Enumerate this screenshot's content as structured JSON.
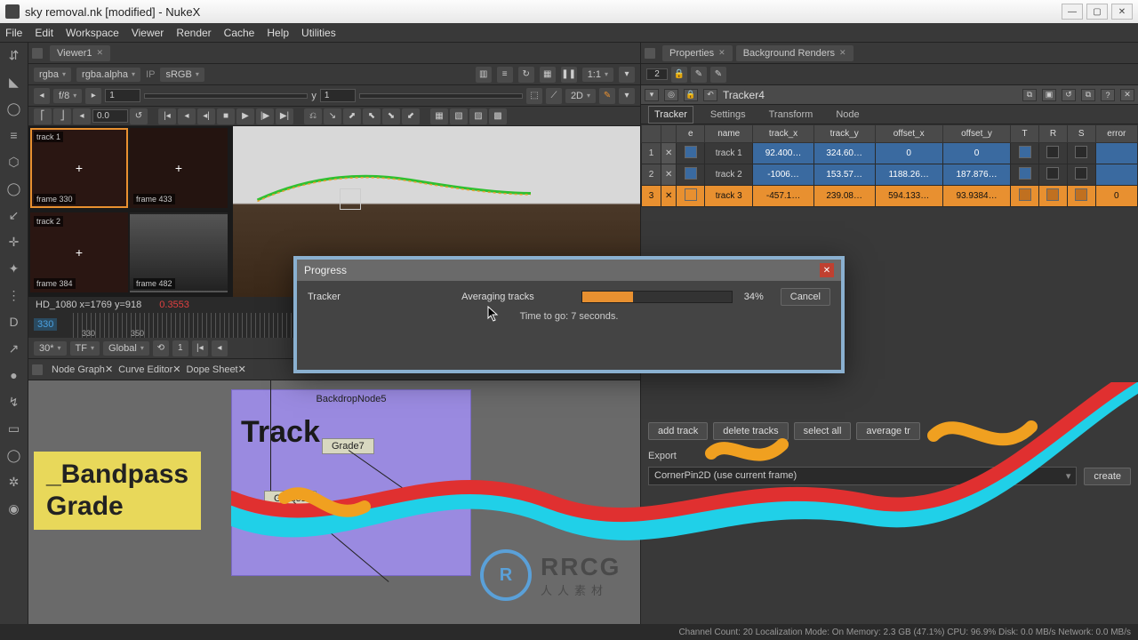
{
  "window": {
    "title": "sky removal.nk [modified] - NukeX"
  },
  "menus": [
    "File",
    "Edit",
    "Workspace",
    "Viewer",
    "Render",
    "Cache",
    "Help",
    "Utilities"
  ],
  "left_tools": [
    "⇵",
    "▲",
    "◯",
    "≡",
    "⬡",
    "◯",
    "↙",
    "✛",
    "✦",
    "⋮",
    "D",
    "↗",
    "●",
    "↯",
    "⌂",
    "◯",
    "✲",
    "◉"
  ],
  "viewer": {
    "tab": "Viewer1",
    "channel": "rgba",
    "alpha": "rgba.alpha",
    "ip": "IP",
    "lut": "sRGB",
    "ratio": "1:1",
    "fstop": "f/8",
    "proxy": "1",
    "ylabel": "y",
    "yval": "1",
    "mode2d": "2D",
    "gain": "0.0",
    "info": "HD_1080   x=1769 y=918",
    "red_val": "0.3553",
    "frame": "330",
    "ticks": [
      "330",
      "350"
    ],
    "fps": "30*",
    "tf": "TF",
    "scope": "Global"
  },
  "thumbs": [
    {
      "track": "track 1",
      "frame": "frame 330"
    },
    {
      "track": "",
      "frame": "frame 433"
    },
    {
      "track": "track 2",
      "frame": "frame 384"
    },
    {
      "track": "",
      "frame": "frame 482"
    }
  ],
  "lower_tabs": [
    "Node Graph",
    "Curve Editor",
    "Dope Sheet"
  ],
  "node_graph": {
    "backdrop": "BackdropNode5",
    "big": "Track",
    "nodes": {
      "grade7": "Grade7",
      "grade1": "Grade1",
      "tracker": "Tracker4"
    },
    "yellow": [
      "_Bandpass",
      " Grade"
    ]
  },
  "props": {
    "tab1": "Properties",
    "tab2": "Background Renders",
    "count": "2",
    "node": "Tracker4",
    "subtabs": [
      "Tracker",
      "Settings",
      "Transform",
      "Node"
    ],
    "cols": [
      "e",
      "name",
      "track_x",
      "track_y",
      "offset_x",
      "offset_y",
      "T",
      "R",
      "S",
      "error"
    ],
    "rows": [
      {
        "n": "1",
        "name": "track 1",
        "tx": "92.400…",
        "ty": "324.60…",
        "ox": "0",
        "oy": "0",
        "err": ""
      },
      {
        "n": "2",
        "name": "track 2",
        "tx": "-1006…",
        "ty": "153.57…",
        "ox": "1188.26…",
        "oy": "187.876…",
        "err": ""
      },
      {
        "n": "3",
        "name": "track 3",
        "tx": "-457.1…",
        "ty": "239.08…",
        "ox": "594.133…",
        "oy": "93.9384…",
        "err": "0"
      }
    ],
    "buttons": [
      "add track",
      "delete tracks",
      "select all",
      "average tr"
    ],
    "export_label": "Export",
    "export_combo": "CornerPin2D (use current frame)",
    "create": "create"
  },
  "dialog": {
    "title": "Progress",
    "tracker": "Tracker",
    "task": "Averaging tracks",
    "pct": "34%",
    "time": "Time to go: 7 seconds.",
    "cancel": "Cancel"
  },
  "status": "Channel Count: 20 Localization Mode: On Memory: 2.3 GB (47.1%) CPU: 96.9% Disk: 0.0 MB/s Network: 0.0 MB/s",
  "watermark": {
    "brand": "RRCG",
    "sub": "人人素材"
  }
}
